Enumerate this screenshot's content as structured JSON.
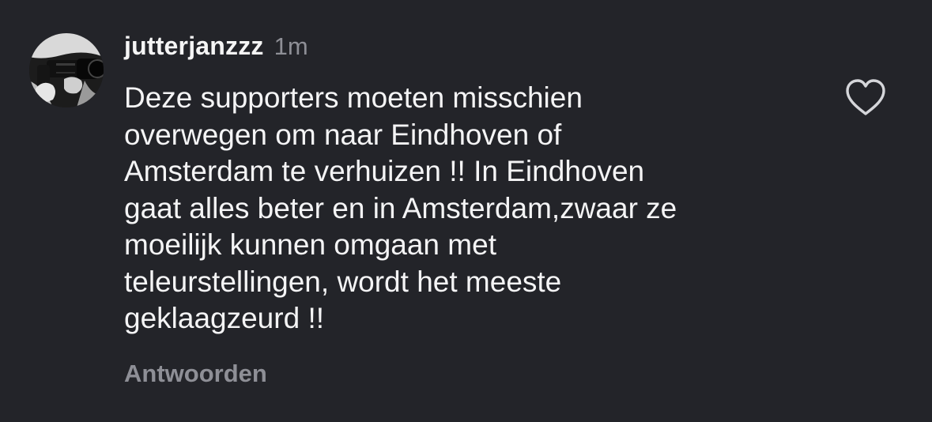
{
  "comment": {
    "username": "jutterjanzzz",
    "timestamp": "1m",
    "text_lines": [
      "Deze supporters moeten misschien",
      "overwegen om naar Eindhoven of",
      "Amsterdam te verhuizen !! In Eindhoven",
      "gaat alles beter en in Amsterdam,zwaar ze",
      "moeilijk kunnen omgaan met",
      "teleurstellingen, wordt het meeste",
      "geklaagzeurd !!"
    ],
    "reply_label": "Antwoorden",
    "like_icon": "heart-outline-icon"
  },
  "colors": {
    "background": "#232429",
    "text": "#f4f4f5",
    "muted": "#8e8f96"
  }
}
